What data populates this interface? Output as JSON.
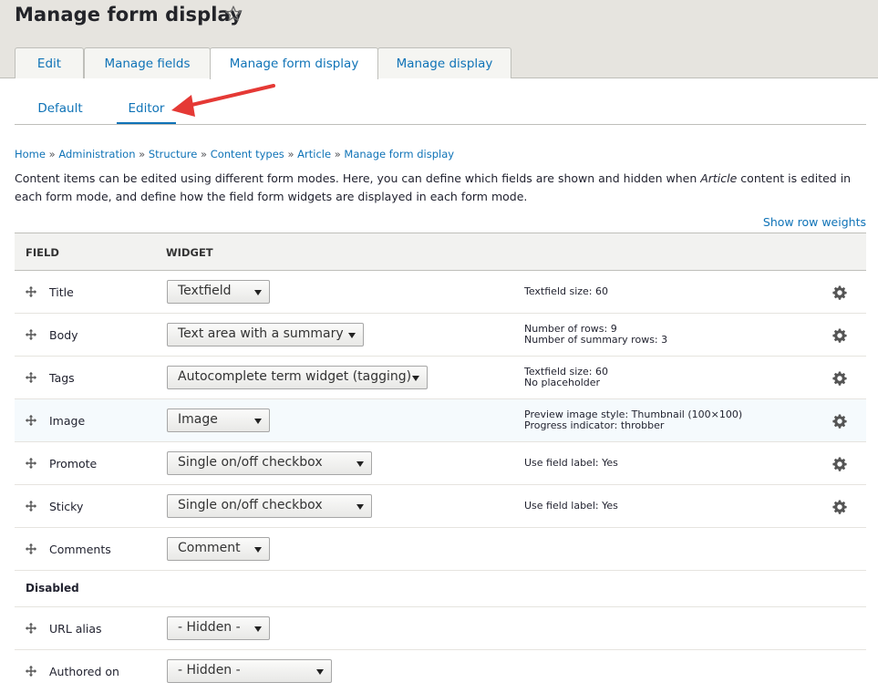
{
  "page": {
    "title": "Manage form display"
  },
  "tabs": [
    {
      "label": "Edit"
    },
    {
      "label": "Manage fields"
    },
    {
      "label": "Manage form display"
    },
    {
      "label": "Manage display"
    }
  ],
  "subtabs": [
    {
      "label": "Default"
    },
    {
      "label": "Editor"
    }
  ],
  "breadcrumb": [
    "Home",
    "Administration",
    "Structure",
    "Content types",
    "Article",
    "Manage form display"
  ],
  "breadcrumb_separator": "»",
  "description": {
    "part1": "Content items can be edited using different form modes. Here, you can define which fields are shown and hidden when ",
    "emphasis": "Article",
    "part2": " content is edited in each form mode, and define how the field form widgets are displayed in each form mode."
  },
  "row_weights_label": "Show row weights",
  "table": {
    "headers": {
      "field": "Field",
      "widget": "Widget"
    },
    "rows": [
      {
        "label": "Title",
        "widget": "Textfield",
        "summary": [
          "Textfield size: 60"
        ]
      },
      {
        "label": "Body",
        "widget": "Text area with a summary",
        "summary": [
          "Number of rows: 9",
          "Number of summary rows: 3"
        ]
      },
      {
        "label": "Tags",
        "widget": "Autocomplete term widget (tagging)",
        "summary": [
          "Textfield size: 60",
          "No placeholder"
        ]
      },
      {
        "label": "Image",
        "widget": "Image",
        "summary": [
          "Preview image style: Thumbnail (100×100)",
          "Progress indicator: throbber"
        ]
      },
      {
        "label": "Promote",
        "widget": "Single on/off checkbox",
        "summary": [
          "Use field label: Yes"
        ]
      },
      {
        "label": "Sticky",
        "widget": "Single on/off checkbox",
        "summary": [
          "Use field label: Yes"
        ]
      },
      {
        "label": "Comments",
        "widget": "Comment",
        "summary": []
      }
    ],
    "disabled_region": "Disabled",
    "disabled_rows": [
      {
        "label": "URL alias",
        "widget": "- Hidden -"
      },
      {
        "label": "Authored on",
        "widget": "- Hidden -"
      }
    ]
  },
  "colors": {
    "link": "#0f73b7",
    "header_band": "#e6e4df",
    "annotation_arrow": "#e53935"
  }
}
